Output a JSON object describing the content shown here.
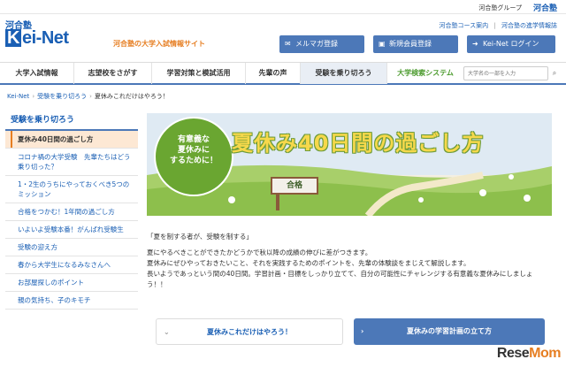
{
  "topbar": {
    "group_text": "河合塾グループ",
    "group_logo": "河合塾"
  },
  "logo": {
    "kanji": "河合塾",
    "k": "K",
    "rest": "ei-Net",
    "subtitle": "河合塾の大学入試情報サイト"
  },
  "header_links": [
    "河合塾コース案内",
    "河合塾の進学情報誌"
  ],
  "header_buttons": [
    {
      "label": "メルマガ登録",
      "icon": "mail-icon"
    },
    {
      "label": "新規会員登録",
      "icon": "user-icon"
    },
    {
      "label": "Kei-Net ログイン",
      "icon": "login-icon"
    }
  ],
  "nav": {
    "items": [
      "大学入試情報",
      "志望校をさがす",
      "学習対策と模試活用",
      "先輩の声",
      "受験を乗り切ろう"
    ],
    "active_index": 4,
    "search_label": "大学検索システム",
    "search_placeholder": "大学名の一部を入力"
  },
  "breadcrumb": [
    "Kei-Net",
    "受験を乗り切ろう",
    "夏休みこれだけはやろう！"
  ],
  "sidebar": {
    "heading": "受験を乗り切ろう",
    "items": [
      "夏休み40日間の過ごし方",
      "コロナ禍の大学受験　先輩たちはどう乗り切った？",
      "1・2生のうちにやっておくべき5つのミッション",
      "合格をつかむ！1年間の過ごし方",
      "いよいよ受験本番！がんばれ受験生",
      "受験の迎え方",
      "春から大学生になるみなさんへ",
      "お部屋探しのポイント",
      "親の気持ち、子のキモチ"
    ],
    "active_index": 0
  },
  "hero": {
    "title": "夏休み40日間の過ごし方",
    "circle_text": "有意義な\n夏休みに\nするために！",
    "sign": "合格"
  },
  "article": {
    "quote": "「夏を制する者が、受験を制する」",
    "p1": "夏にやるべきことができたかどうかで秋以降の成績の伸びに差がつきます。",
    "p2": "夏休みにぜひやっておきたいこと、それを実践するためのポイントを、先輩の体験談をまじえて解説します。",
    "p3": "長いようであっという間の40日間。学習計画・目標をしっかり立てて、自分の可能性にチャレンジする有意義な夏休みにしましょう！！"
  },
  "bottom_buttons": [
    "夏休みこれだけはやろう！",
    "夏休みの学習計画の立て方"
  ],
  "watermark": {
    "a": "Rese",
    "b": "Mom"
  }
}
